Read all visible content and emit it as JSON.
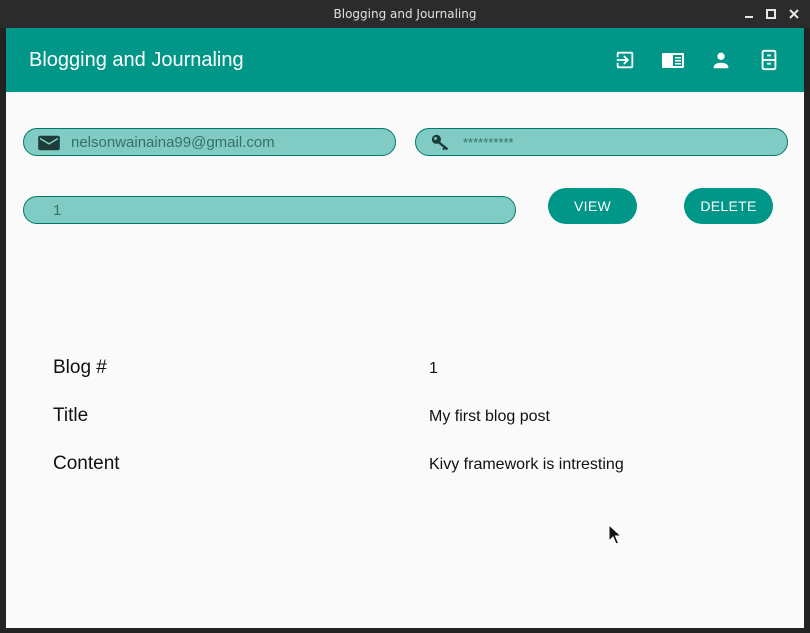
{
  "window": {
    "title": "Blogging and Journaling"
  },
  "appbar": {
    "title": "Blogging and Journaling",
    "color": "#009688",
    "actions": [
      {
        "icon": "login-icon"
      },
      {
        "icon": "book-open-icon"
      },
      {
        "icon": "account-icon"
      },
      {
        "icon": "file-cabinet-icon"
      }
    ]
  },
  "form": {
    "email": {
      "value": "nelsonwainaina99@gmail.com",
      "icon": "email-icon"
    },
    "password": {
      "value": "**********",
      "icon": "key-icon"
    },
    "blog_id": {
      "value": "1"
    },
    "view_label": "VIEW",
    "delete_label": "DELETE"
  },
  "details": {
    "rows": [
      {
        "label": "Blog #",
        "value": "1"
      },
      {
        "label": "Title",
        "value": "My first blog post"
      },
      {
        "label": "Content",
        "value": "Kivy framework is intresting"
      }
    ]
  }
}
